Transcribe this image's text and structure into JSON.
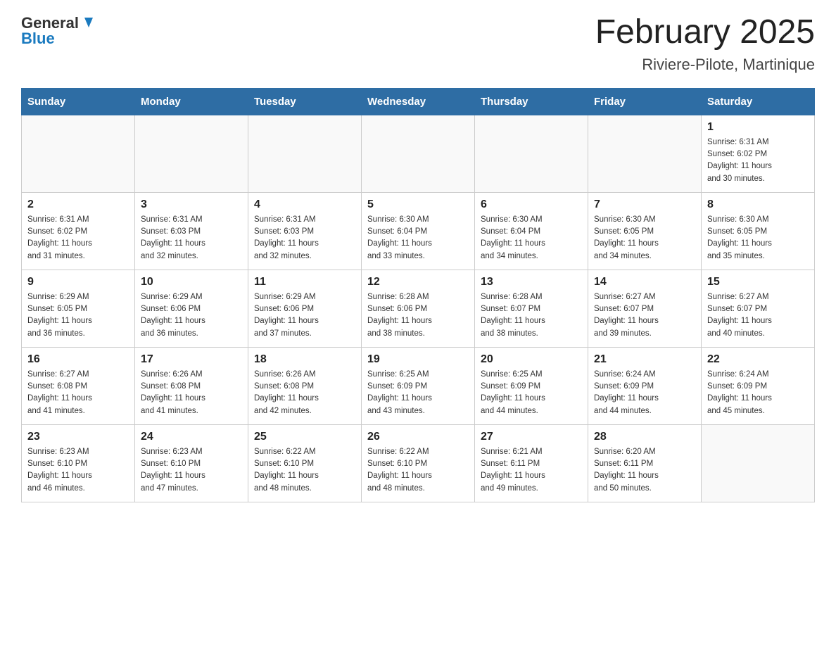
{
  "header": {
    "logo_general": "General",
    "logo_blue": "Blue",
    "month_title": "February 2025",
    "location": "Riviere-Pilote, Martinique"
  },
  "weekdays": [
    "Sunday",
    "Monday",
    "Tuesday",
    "Wednesday",
    "Thursday",
    "Friday",
    "Saturday"
  ],
  "weeks": [
    [
      {
        "day": "",
        "info": ""
      },
      {
        "day": "",
        "info": ""
      },
      {
        "day": "",
        "info": ""
      },
      {
        "day": "",
        "info": ""
      },
      {
        "day": "",
        "info": ""
      },
      {
        "day": "",
        "info": ""
      },
      {
        "day": "1",
        "info": "Sunrise: 6:31 AM\nSunset: 6:02 PM\nDaylight: 11 hours\nand 30 minutes."
      }
    ],
    [
      {
        "day": "2",
        "info": "Sunrise: 6:31 AM\nSunset: 6:02 PM\nDaylight: 11 hours\nand 31 minutes."
      },
      {
        "day": "3",
        "info": "Sunrise: 6:31 AM\nSunset: 6:03 PM\nDaylight: 11 hours\nand 32 minutes."
      },
      {
        "day": "4",
        "info": "Sunrise: 6:31 AM\nSunset: 6:03 PM\nDaylight: 11 hours\nand 32 minutes."
      },
      {
        "day": "5",
        "info": "Sunrise: 6:30 AM\nSunset: 6:04 PM\nDaylight: 11 hours\nand 33 minutes."
      },
      {
        "day": "6",
        "info": "Sunrise: 6:30 AM\nSunset: 6:04 PM\nDaylight: 11 hours\nand 34 minutes."
      },
      {
        "day": "7",
        "info": "Sunrise: 6:30 AM\nSunset: 6:05 PM\nDaylight: 11 hours\nand 34 minutes."
      },
      {
        "day": "8",
        "info": "Sunrise: 6:30 AM\nSunset: 6:05 PM\nDaylight: 11 hours\nand 35 minutes."
      }
    ],
    [
      {
        "day": "9",
        "info": "Sunrise: 6:29 AM\nSunset: 6:05 PM\nDaylight: 11 hours\nand 36 minutes."
      },
      {
        "day": "10",
        "info": "Sunrise: 6:29 AM\nSunset: 6:06 PM\nDaylight: 11 hours\nand 36 minutes."
      },
      {
        "day": "11",
        "info": "Sunrise: 6:29 AM\nSunset: 6:06 PM\nDaylight: 11 hours\nand 37 minutes."
      },
      {
        "day": "12",
        "info": "Sunrise: 6:28 AM\nSunset: 6:06 PM\nDaylight: 11 hours\nand 38 minutes."
      },
      {
        "day": "13",
        "info": "Sunrise: 6:28 AM\nSunset: 6:07 PM\nDaylight: 11 hours\nand 38 minutes."
      },
      {
        "day": "14",
        "info": "Sunrise: 6:27 AM\nSunset: 6:07 PM\nDaylight: 11 hours\nand 39 minutes."
      },
      {
        "day": "15",
        "info": "Sunrise: 6:27 AM\nSunset: 6:07 PM\nDaylight: 11 hours\nand 40 minutes."
      }
    ],
    [
      {
        "day": "16",
        "info": "Sunrise: 6:27 AM\nSunset: 6:08 PM\nDaylight: 11 hours\nand 41 minutes."
      },
      {
        "day": "17",
        "info": "Sunrise: 6:26 AM\nSunset: 6:08 PM\nDaylight: 11 hours\nand 41 minutes."
      },
      {
        "day": "18",
        "info": "Sunrise: 6:26 AM\nSunset: 6:08 PM\nDaylight: 11 hours\nand 42 minutes."
      },
      {
        "day": "19",
        "info": "Sunrise: 6:25 AM\nSunset: 6:09 PM\nDaylight: 11 hours\nand 43 minutes."
      },
      {
        "day": "20",
        "info": "Sunrise: 6:25 AM\nSunset: 6:09 PM\nDaylight: 11 hours\nand 44 minutes."
      },
      {
        "day": "21",
        "info": "Sunrise: 6:24 AM\nSunset: 6:09 PM\nDaylight: 11 hours\nand 44 minutes."
      },
      {
        "day": "22",
        "info": "Sunrise: 6:24 AM\nSunset: 6:09 PM\nDaylight: 11 hours\nand 45 minutes."
      }
    ],
    [
      {
        "day": "23",
        "info": "Sunrise: 6:23 AM\nSunset: 6:10 PM\nDaylight: 11 hours\nand 46 minutes."
      },
      {
        "day": "24",
        "info": "Sunrise: 6:23 AM\nSunset: 6:10 PM\nDaylight: 11 hours\nand 47 minutes."
      },
      {
        "day": "25",
        "info": "Sunrise: 6:22 AM\nSunset: 6:10 PM\nDaylight: 11 hours\nand 48 minutes."
      },
      {
        "day": "26",
        "info": "Sunrise: 6:22 AM\nSunset: 6:10 PM\nDaylight: 11 hours\nand 48 minutes."
      },
      {
        "day": "27",
        "info": "Sunrise: 6:21 AM\nSunset: 6:11 PM\nDaylight: 11 hours\nand 49 minutes."
      },
      {
        "day": "28",
        "info": "Sunrise: 6:20 AM\nSunset: 6:11 PM\nDaylight: 11 hours\nand 50 minutes."
      },
      {
        "day": "",
        "info": ""
      }
    ]
  ]
}
